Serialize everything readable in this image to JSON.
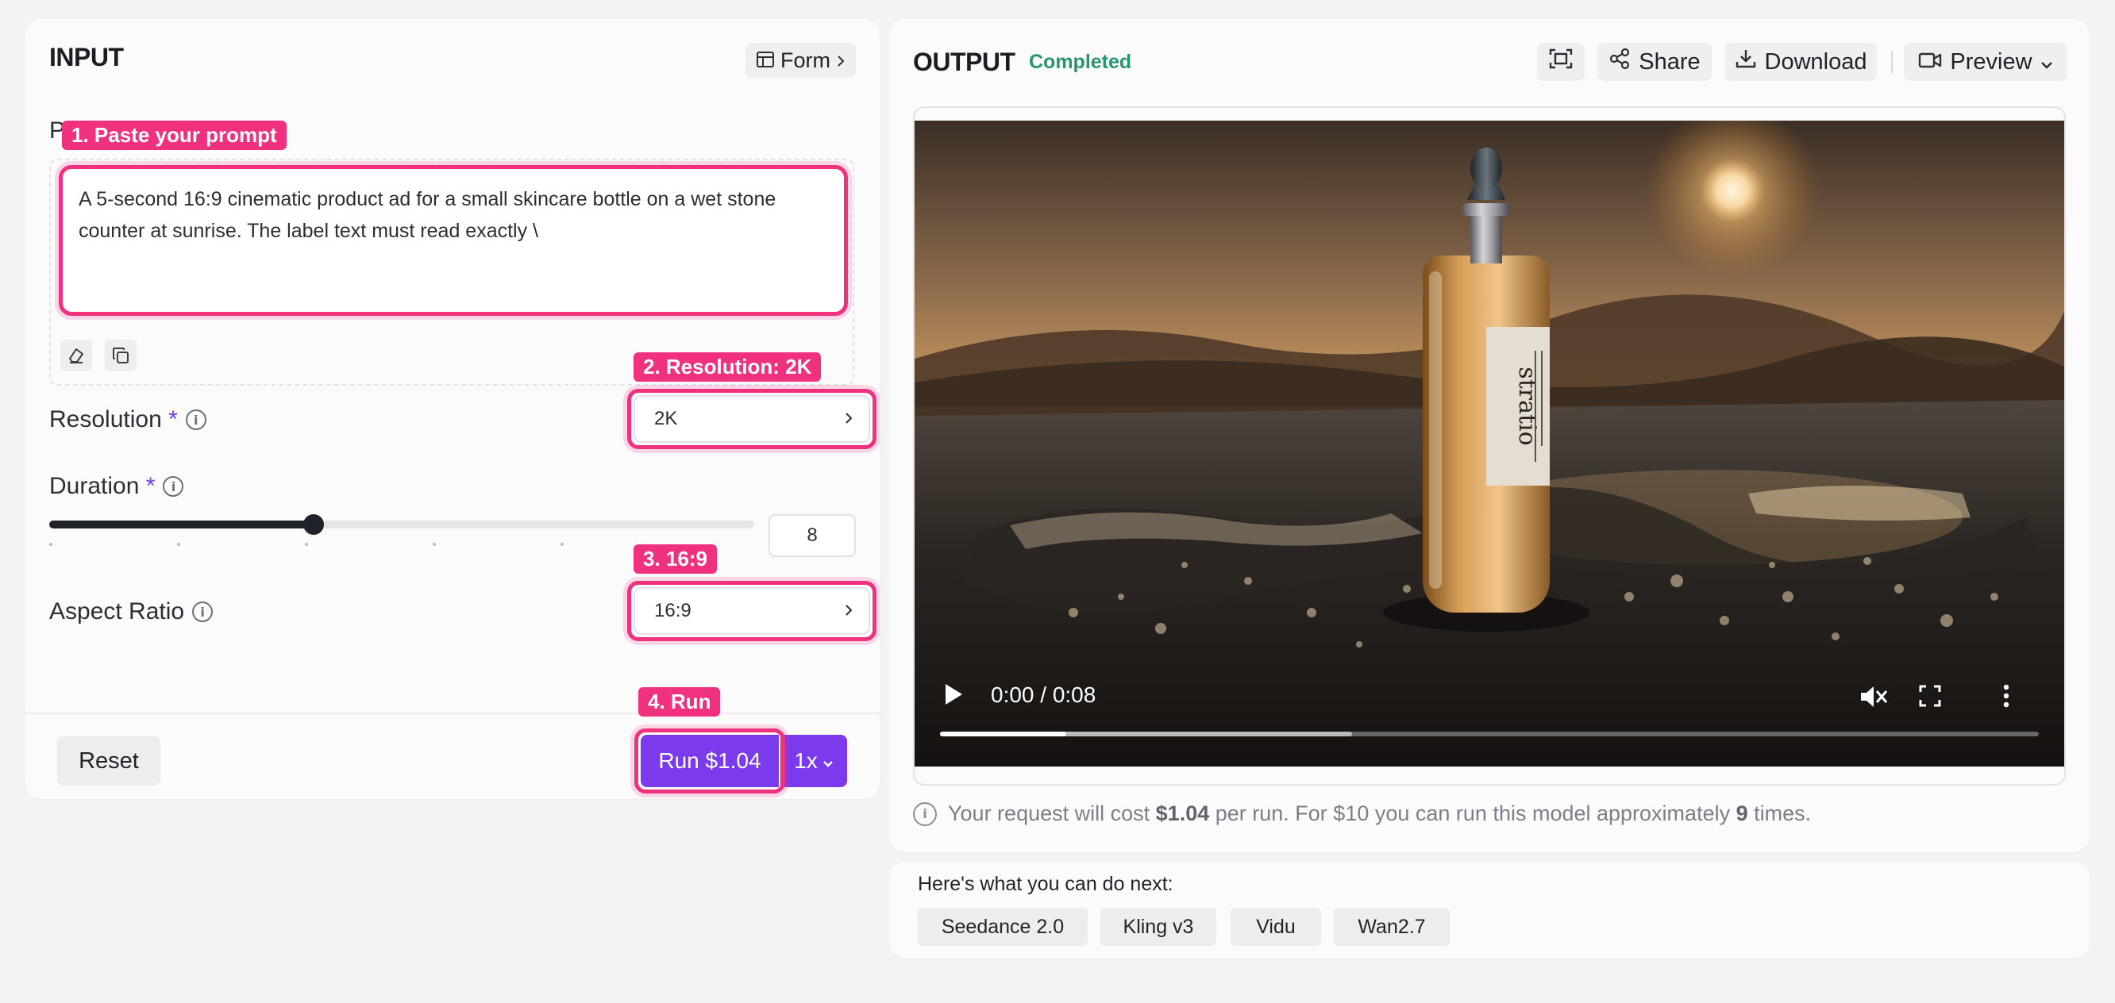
{
  "input": {
    "title": "INPUT",
    "view_toggle_label": "Form",
    "prompt": {
      "label": "P",
      "value": "A 5-second 16:9 cinematic product ad for a small skincare bottle on a wet stone counter at sunrise. The label text must read exactly \\"
    },
    "resolution": {
      "label": "Resolution",
      "required_mark": "*",
      "value": "2K"
    },
    "duration": {
      "label": "Duration",
      "required_mark": "*",
      "value": "8",
      "slider_fraction": 0.375
    },
    "aspect_ratio": {
      "label": "Aspect Ratio",
      "value": "16:9"
    },
    "footer": {
      "reset_label": "Reset",
      "run_label": "Run $1.04",
      "multiplier_label": "1x"
    }
  },
  "annotations": {
    "step1": "1. Paste your prompt",
    "step2": "2. Resolution: 2K",
    "step3": "3. 16:9",
    "step4": "4. Run"
  },
  "output": {
    "title": "OUTPUT",
    "status": "Completed",
    "status_color": "#27956f",
    "share_label": "Share",
    "download_label": "Download",
    "preview_label": "Preview",
    "video": {
      "time": "0:00 / 0:08",
      "bottle_label": "stratio",
      "played_fraction": 0.115,
      "buffered_fraction": 0.375
    },
    "cost": {
      "prefix": "Your request will cost",
      "price": "$1.04",
      "middle": "per run. For $10 you can run this model approximately",
      "count": "9",
      "suffix": "times."
    }
  },
  "next": {
    "title": "Here's what you can do next:",
    "chips": [
      "Seedance 2.0",
      "Kling v3",
      "Vidu",
      "Wan2.7"
    ]
  },
  "colors": {
    "accent": "#7c3aed",
    "highlight": "#f0317d"
  }
}
